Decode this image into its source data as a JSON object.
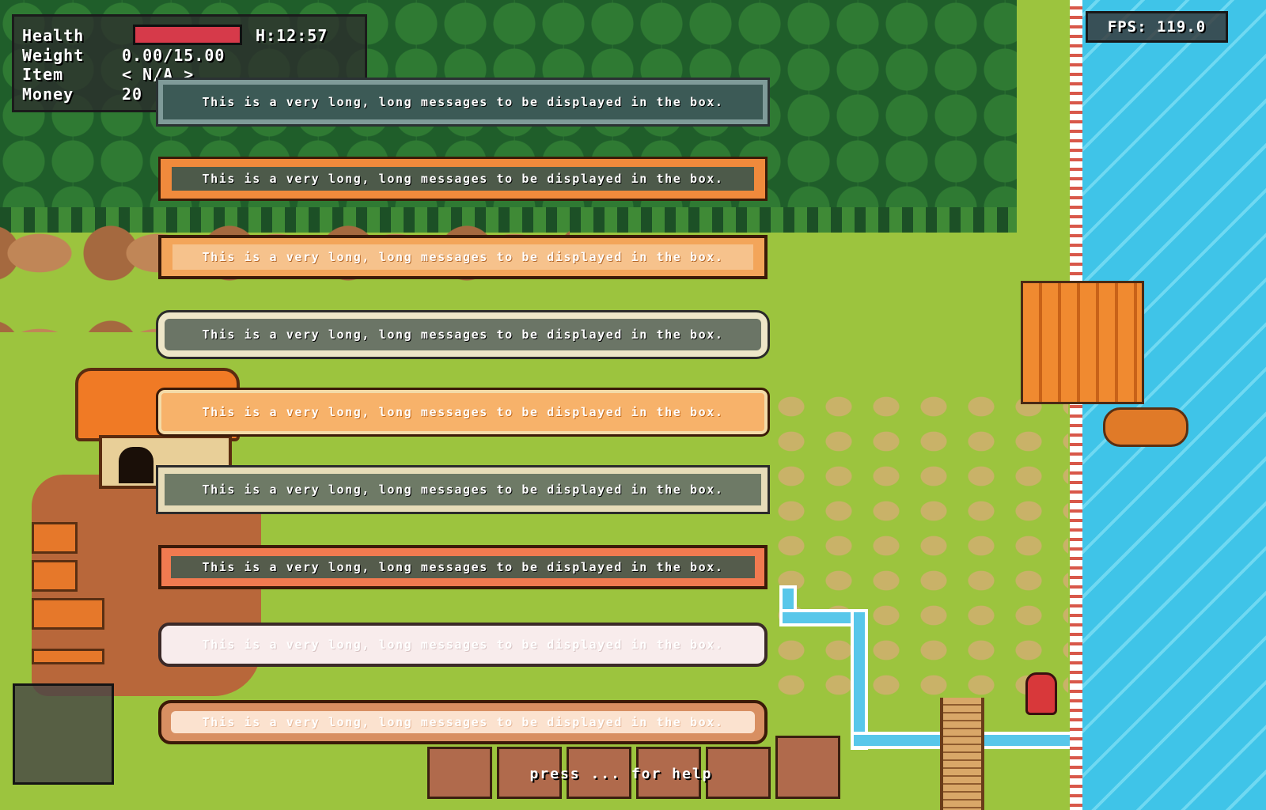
{
  "hud": {
    "health_label": "Health",
    "weight_label": "Weight",
    "weight_value": "0.00/15.00",
    "item_label": "Item",
    "item_value": "< N/A >",
    "money_label": "Money",
    "money_value": "20",
    "time": "H:12:57",
    "fps": "FPS: 119.0",
    "help_hint": "press ... for help"
  },
  "colors": {
    "health_bar": "#d63a4a",
    "water": "#3fc4e8",
    "grass": "#9cc43e",
    "forest": "#276b2f"
  },
  "message_boxes": [
    {
      "text": "This is a very long, long messages to be displayed in the box.",
      "style": "slate-frame"
    },
    {
      "text": "This is a very long, long messages to be displayed in the box.",
      "style": "orange-frame-dark-inset"
    },
    {
      "text": "This is a very long, long messages to be displayed in the box.",
      "style": "orange-light"
    },
    {
      "text": "This is a very long, long messages to be displayed in the box.",
      "style": "cream-rounded-dark"
    },
    {
      "text": "This is a very long, long messages to be displayed in the box.",
      "style": "peach-rounded"
    },
    {
      "text": "This is a very long, long messages to be displayed in the box.",
      "style": "cream-square-dark"
    },
    {
      "text": "This is a very long, long messages to be displayed in the box.",
      "style": "coral-frame-dark-inset"
    },
    {
      "text": "This is a very long, long messages to be displayed in the box.",
      "style": "pale-pink-rounded"
    },
    {
      "text": "This is a very long, long messages to be displayed in the box.",
      "style": "tan-frame-light-inset"
    }
  ],
  "icons": [
    "tree-icon",
    "rock-icon",
    "house-icon",
    "dock-icon",
    "boat-icon",
    "bridge-icon",
    "player-icon"
  ]
}
